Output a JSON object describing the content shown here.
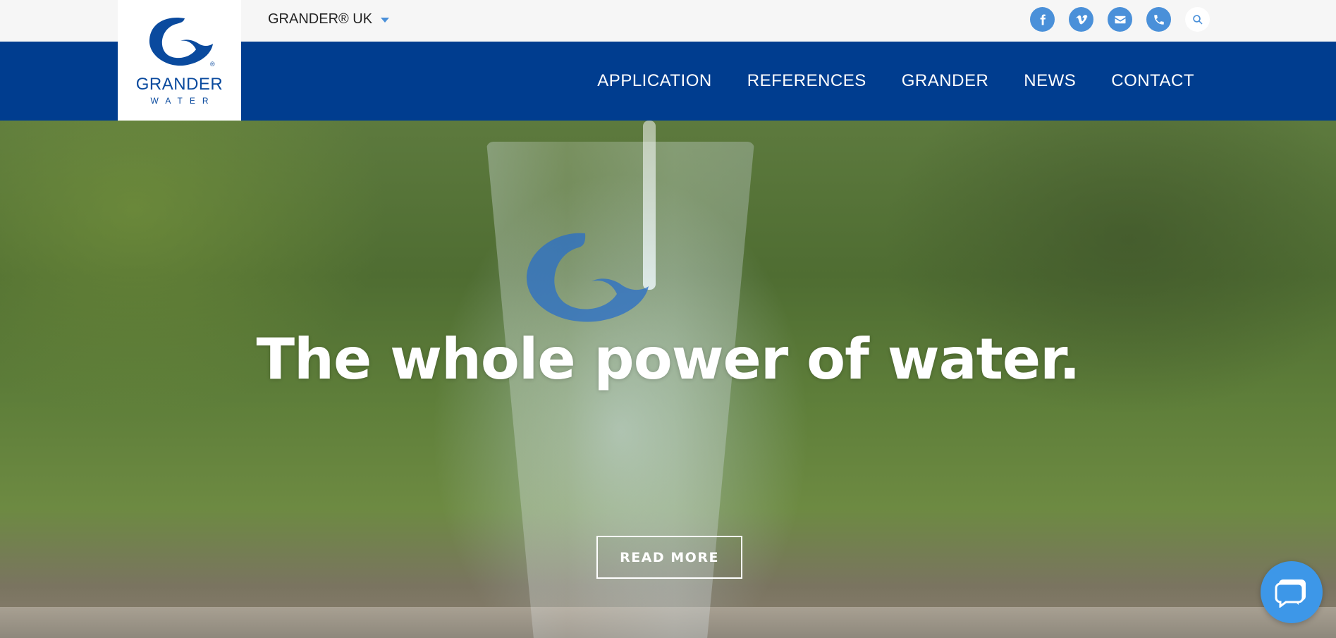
{
  "brand": {
    "name": "GRANDER",
    "tagline": "WATER",
    "color": "#0a4a9e"
  },
  "topbar": {
    "region_label": "GRANDER® UK",
    "social_icons": [
      "facebook-icon",
      "vimeo-icon",
      "email-icon",
      "phone-icon",
      "search-icon"
    ]
  },
  "nav": {
    "items": [
      {
        "label": "APPLICATION"
      },
      {
        "label": "REFERENCES"
      },
      {
        "label": "GRANDER"
      },
      {
        "label": "NEWS"
      },
      {
        "label": "CONTACT"
      }
    ]
  },
  "hero": {
    "headline_part1": "The whole ",
    "headline_bold1": "power",
    "headline_part2": " of ",
    "headline_bold2": "water",
    "headline_end": ".",
    "cta_label": "READ MORE"
  },
  "colors": {
    "nav_bg": "#003d8f",
    "accent": "#4a90d9",
    "chat": "#3d97e8"
  }
}
